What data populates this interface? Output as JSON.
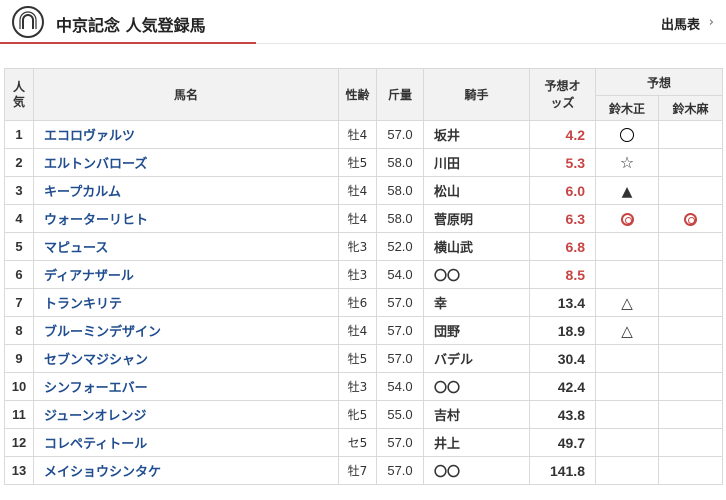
{
  "header": {
    "title": "中京記念 人気登録馬",
    "entries_link": "出馬表",
    "logo_icon": "horseshoe-icon",
    "accent_color": "#c74444"
  },
  "table": {
    "headers": {
      "rank": "人気",
      "name": "馬名",
      "sexage": "性齢",
      "weight": "斤量",
      "jockey": "騎手",
      "odds": "予想オッズ",
      "prediction": "予想",
      "pred_a": "鈴木正",
      "pred_b": "鈴木麻"
    },
    "rows": [
      {
        "rank": "1",
        "name": "エコロヴァルツ",
        "sexage": "牡4",
        "weight": "57.0",
        "jockey": "坂井",
        "odds": "4.2",
        "pred_a": "circle",
        "pred_b": ""
      },
      {
        "rank": "2",
        "name": "エルトンバローズ",
        "sexage": "牡5",
        "weight": "58.0",
        "jockey": "川田",
        "odds": "5.3",
        "pred_a": "star",
        "pred_b": ""
      },
      {
        "rank": "3",
        "name": "キープカルム",
        "sexage": "牡4",
        "weight": "58.0",
        "jockey": "松山",
        "odds": "6.0",
        "pred_a": "triangle-filled",
        "pred_b": ""
      },
      {
        "rank": "4",
        "name": "ウォーターリヒト",
        "sexage": "牡4",
        "weight": "58.0",
        "jockey": "菅原明",
        "odds": "6.3",
        "pred_a": "double-circle",
        "pred_b": "double-circle"
      },
      {
        "rank": "5",
        "name": "マピュース",
        "sexage": "牝3",
        "weight": "52.0",
        "jockey": "横山武",
        "odds": "6.8",
        "pred_a": "",
        "pred_b": ""
      },
      {
        "rank": "6",
        "name": "ディアナザール",
        "sexage": "牡3",
        "weight": "54.0",
        "jockey": "〇〇",
        "odds": "8.5",
        "pred_a": "",
        "pred_b": ""
      },
      {
        "rank": "7",
        "name": "トランキリテ",
        "sexage": "牡6",
        "weight": "57.0",
        "jockey": "幸",
        "odds": "13.4",
        "pred_a": "triangle",
        "pred_b": ""
      },
      {
        "rank": "8",
        "name": "ブルーミンデザイン",
        "sexage": "牡4",
        "weight": "57.0",
        "jockey": "団野",
        "odds": "18.9",
        "pred_a": "triangle",
        "pred_b": ""
      },
      {
        "rank": "9",
        "name": "セブンマジシャン",
        "sexage": "牡5",
        "weight": "57.0",
        "jockey": "バデル",
        "odds": "30.4",
        "pred_a": "",
        "pred_b": ""
      },
      {
        "rank": "10",
        "name": "シンフォーエバー",
        "sexage": "牡3",
        "weight": "54.0",
        "jockey": "〇〇",
        "odds": "42.4",
        "pred_a": "",
        "pred_b": ""
      },
      {
        "rank": "11",
        "name": "ジューンオレンジ",
        "sexage": "牝5",
        "weight": "55.0",
        "jockey": "吉村",
        "odds": "43.8",
        "pred_a": "",
        "pred_b": ""
      },
      {
        "rank": "12",
        "name": "コレペティトール",
        "sexage": "セ5",
        "weight": "57.0",
        "jockey": "井上",
        "odds": "49.7",
        "pred_a": "",
        "pred_b": ""
      },
      {
        "rank": "13",
        "name": "メイショウシンタケ",
        "sexage": "牡7",
        "weight": "57.0",
        "jockey": "〇〇",
        "odds": "141.8",
        "pred_a": "",
        "pred_b": ""
      }
    ]
  }
}
